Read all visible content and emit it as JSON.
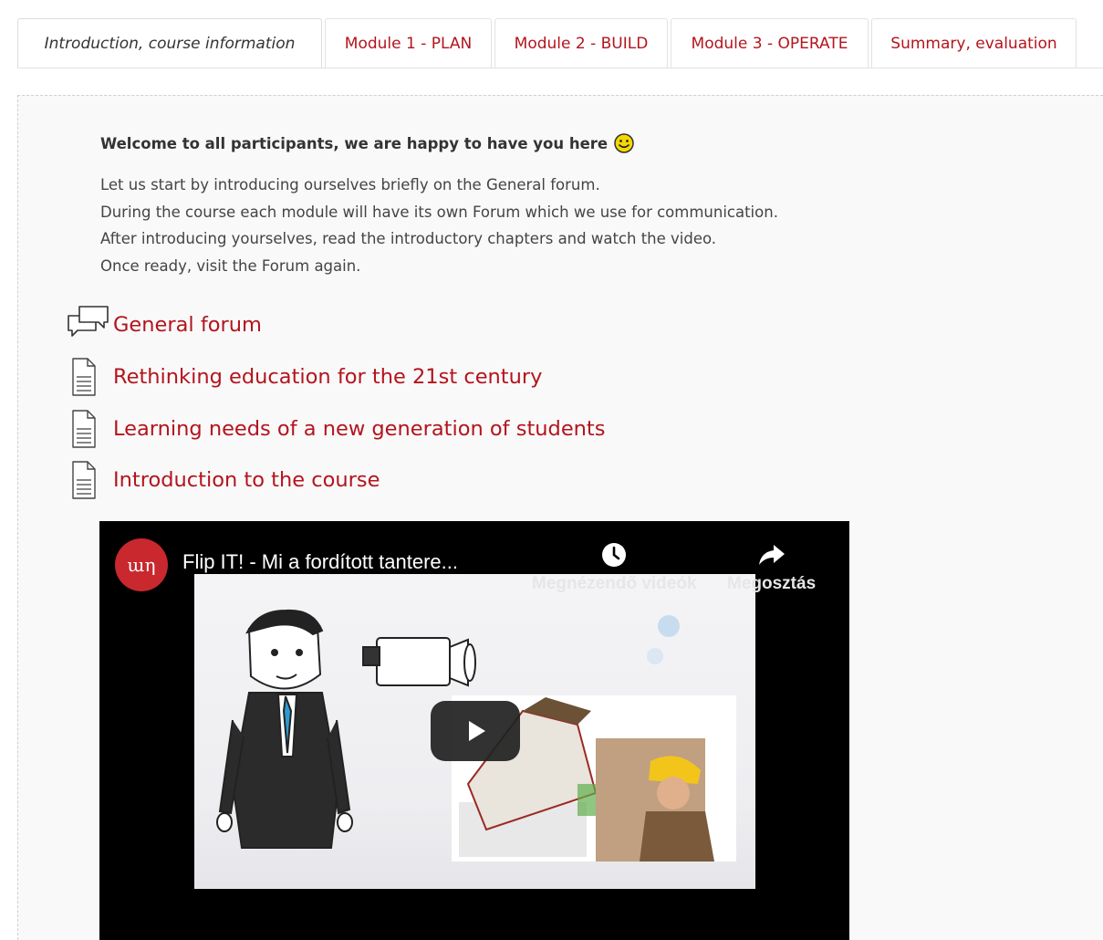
{
  "tabs": [
    {
      "label": "Introduction, course information",
      "active": true
    },
    {
      "label": "Module 1 - PLAN",
      "active": false
    },
    {
      "label": "Module 2 - BUILD",
      "active": false
    },
    {
      "label": "Module 3 - OPERATE",
      "active": false
    },
    {
      "label": "Summary, evaluation",
      "active": false
    }
  ],
  "welcome": {
    "heading": "Welcome to all participants, we are happy to have you here",
    "lines": [
      "Let us start by introducing ourselves briefly on the General forum.",
      "During the course each module will have its own Forum which we use for communication.",
      "After introducing yourselves, read the introductory chapters and watch the video.",
      "Once ready, visit the Forum again."
    ]
  },
  "activities": [
    {
      "label": "General forum",
      "icon": "forum-icon"
    },
    {
      "label": "Rethinking education for the 21st century",
      "icon": "page-icon"
    },
    {
      "label": "Learning needs of a new generation of students",
      "icon": "page-icon"
    },
    {
      "label": "Introduction to the course",
      "icon": "page-icon"
    }
  ],
  "video": {
    "channel_logo_text": "ɯη",
    "title": "Flip IT! - Mi a fordított tantere...",
    "watch_later_label": "Megnézendő videók",
    "share_label": "Megosztás"
  },
  "colors": {
    "link": "#b4141d",
    "text": "#444444",
    "panel_bg": "#f9f9f9"
  }
}
